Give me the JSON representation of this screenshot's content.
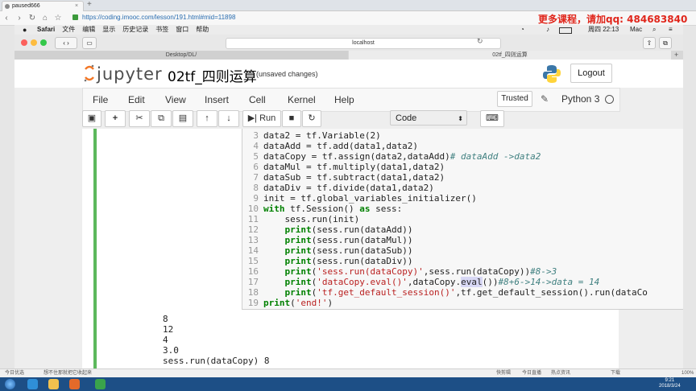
{
  "outer_browser": {
    "tab_title": "paused666",
    "url": "https://coding.imooc.com/lesson/191.html#mid=11898",
    "promo_text": "更多课程，请加qq: 484683840"
  },
  "mac_menubar": {
    "items": [
      "Safari",
      "文件",
      "编辑",
      "显示",
      "历史记录",
      "书签",
      "窗口",
      "帮助"
    ],
    "right_status": "周四 22:13",
    "user": "Mac"
  },
  "safari": {
    "address": "localhost",
    "tabs": [
      "Desktop/DL/",
      "02tf_四则运算"
    ]
  },
  "jupyter": {
    "logo_text": "jupyter",
    "notebook_title": "02tf_四则运算",
    "save_status": "(unsaved changes)",
    "logout_label": "Logout",
    "menu": [
      "File",
      "Edit",
      "View",
      "Insert",
      "Cell",
      "Kernel",
      "Help"
    ],
    "trusted_label": "Trusted",
    "kernel_name": "Python 3",
    "run_label": "Run",
    "cell_type": "Code"
  },
  "code_lines": [
    {
      "n": "3",
      "html": "data2 = tf.Variable(2)"
    },
    {
      "n": "4",
      "html": "dataAdd = tf.add(data1,data2)"
    },
    {
      "n": "5",
      "html": "dataCopy = tf.assign(data2,dataAdd)<span class=\"cmt\"># dataAdd ->data2</span>"
    },
    {
      "n": "6",
      "html": "dataMul = tf.multiply(data1,data2)"
    },
    {
      "n": "7",
      "html": "dataSub = tf.subtract(data1,data2)"
    },
    {
      "n": "8",
      "html": "dataDiv = tf.divide(data1,data2)"
    },
    {
      "n": "9",
      "html": "init = tf.global_variables_initializer()"
    },
    {
      "n": "10",
      "html": "<span class=\"kw\">with</span> tf.Session() <span class=\"kw\">as</span> sess:"
    },
    {
      "n": "11",
      "html": "    sess.run(init)"
    },
    {
      "n": "12",
      "html": "    <span class=\"kw\">print</span>(sess.run(dataAdd))"
    },
    {
      "n": "13",
      "html": "    <span class=\"kw\">print</span>(sess.run(dataMul))"
    },
    {
      "n": "14",
      "html": "    <span class=\"kw\">print</span>(sess.run(dataSub))"
    },
    {
      "n": "15",
      "html": "    <span class=\"kw\">print</span>(sess.run(dataDiv))"
    },
    {
      "n": "16",
      "html": "    <span class=\"kw\">print</span>(<span class=\"str\">'sess.run(dataCopy)'</span>,sess.run(dataCopy))<span class=\"cmt\">#8->3</span>"
    },
    {
      "n": "17",
      "html": "    <span class=\"kw\">print</span>(<span class=\"str\">'dataCopy.eval()'</span>,dataCopy.<span class=\"hl\">eval</span>())<span class=\"cmt\">#8+6->14->data = 14</span>"
    },
    {
      "n": "18",
      "html": "    <span class=\"kw\">print</span>(<span class=\"str\">'tf.get_default_session()'</span>,tf.get_default_session().run(dataCo"
    },
    {
      "n": "19",
      "html": "<span class=\"kw\">print</span>(<span class=\"str\">'end!'</span>)"
    }
  ],
  "output_lines": [
    "8",
    "12",
    "4",
    "3.0",
    "sess.run(dataCopy) 8"
  ],
  "status_bar": {
    "left1": "今日优选",
    "left2": "想不住那就把它收起来",
    "right": [
      "快剪辑",
      "今日直播",
      "热点资讯",
      "下载",
      "100%"
    ]
  },
  "clock": {
    "time": "9:21",
    "date": "2018/3/24"
  }
}
